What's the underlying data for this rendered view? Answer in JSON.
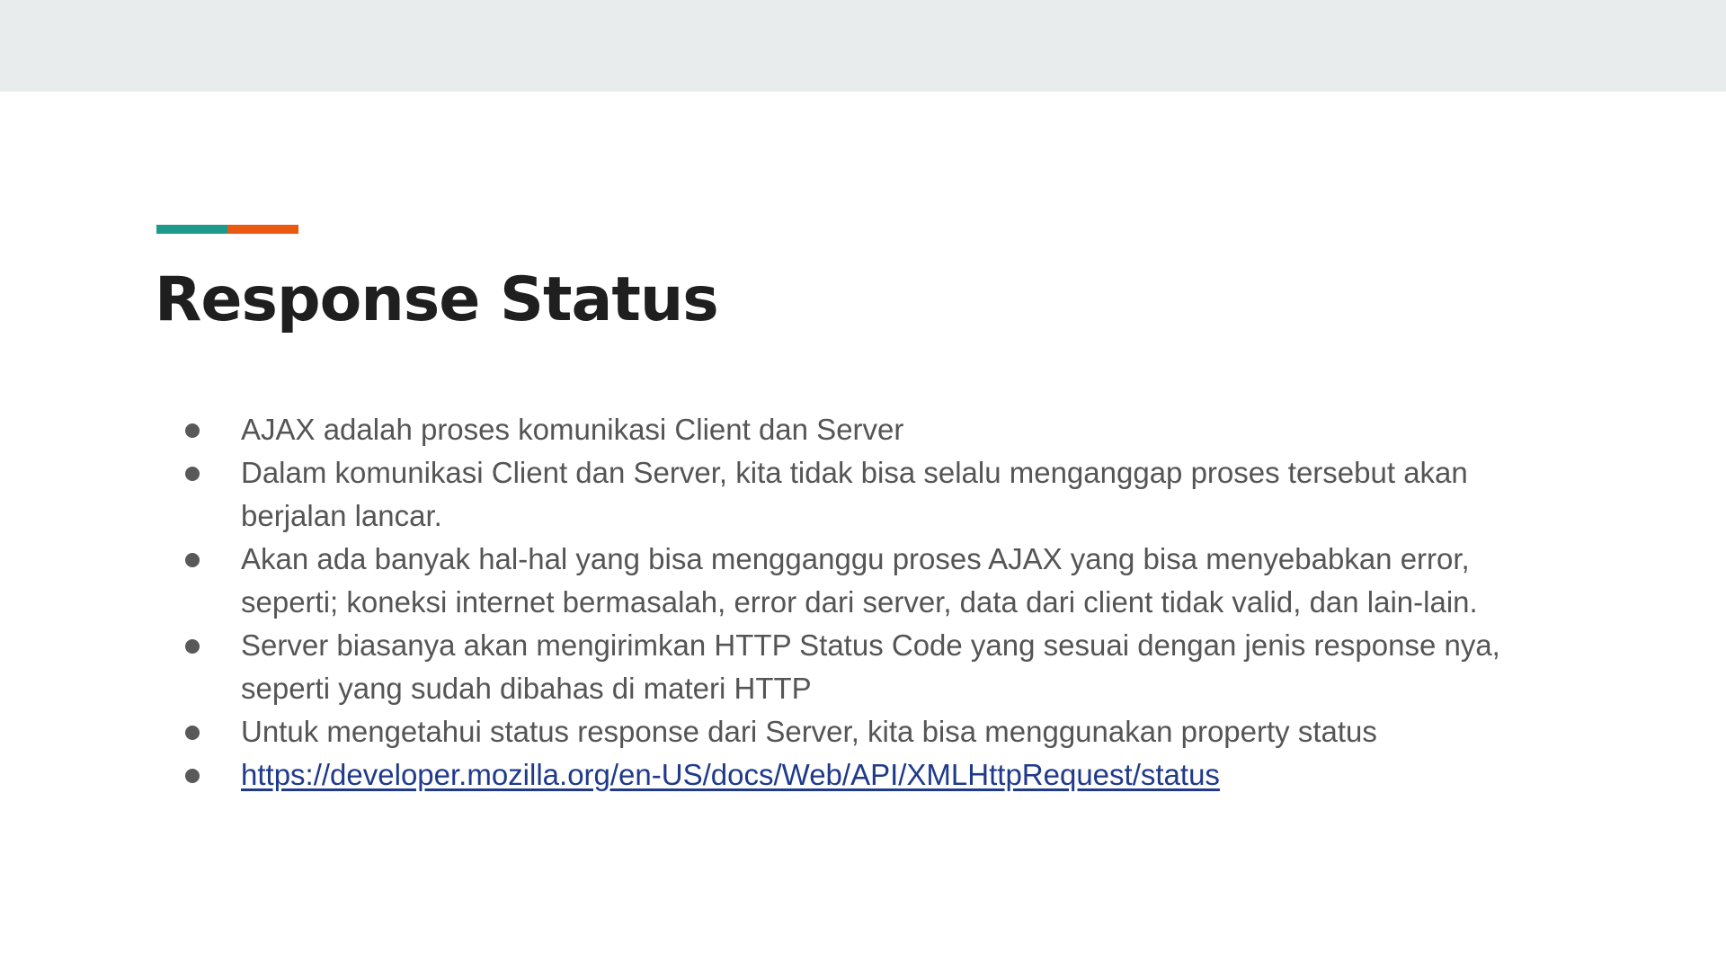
{
  "slide": {
    "title": "Response Status",
    "accent_colors": [
      "#1e9a8c",
      "#e9590f"
    ],
    "bullets": [
      {
        "text": "AJAX adalah proses komunikasi Client dan Server",
        "is_link": false
      },
      {
        "text": "Dalam komunikasi Client dan Server, kita tidak bisa selalu menganggap proses tersebut akan berjalan lancar.",
        "is_link": false
      },
      {
        "text": "Akan ada banyak hal-hal yang bisa mengganggu proses AJAX yang bisa menyebabkan error, seperti; koneksi internet bermasalah, error dari server, data dari client tidak valid, dan lain-lain.",
        "is_link": false
      },
      {
        "text": "Server biasanya akan mengirimkan HTTP Status Code yang sesuai dengan jenis response nya, seperti yang sudah dibahas di materi HTTP",
        "is_link": false
      },
      {
        "text": "Untuk mengetahui status response dari Server, kita bisa menggunakan property status",
        "is_link": false
      },
      {
        "text": "https://developer.mozilla.org/en-US/docs/Web/API/XMLHttpRequest/status",
        "is_link": true
      }
    ]
  }
}
